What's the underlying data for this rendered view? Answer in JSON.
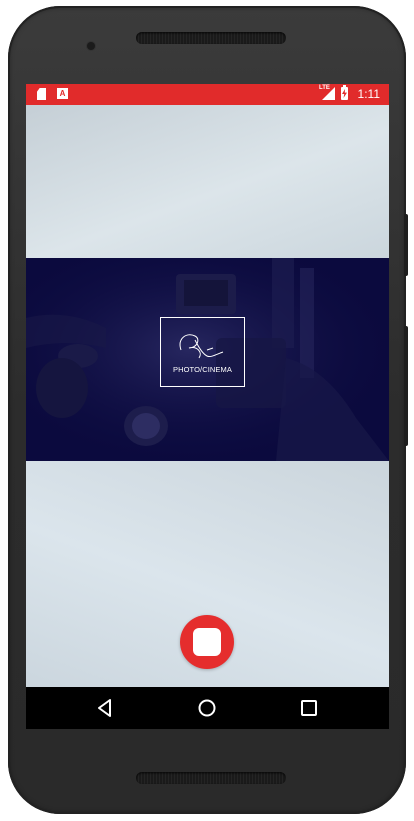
{
  "status_bar": {
    "time": "1:11",
    "network_label": "LTE",
    "left_icons": [
      "sd-card-icon",
      "a-icon"
    ],
    "right_icons": [
      "signal-icon",
      "battery-charging-icon"
    ],
    "a_glyph": "A",
    "background_color": "#e12b2b"
  },
  "hero": {
    "logo_text": "PHOTO/CINEMA",
    "logo_icon": "signature-logo-icon",
    "overlay_color": "#0b0a3e"
  },
  "record": {
    "icon": "stop-icon",
    "color": "#e52d2d"
  },
  "nav": {
    "items": [
      "back-icon",
      "home-icon",
      "recents-icon"
    ]
  }
}
